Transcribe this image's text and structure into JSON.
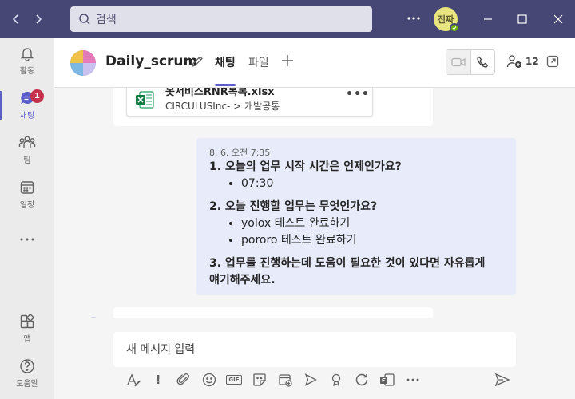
{
  "search": {
    "placeholder": "검색"
  },
  "titlebar": {
    "avatar_initials": "진짜",
    "presence": "available"
  },
  "rail": {
    "items": [
      {
        "label": "활동",
        "icon": "bell-icon"
      },
      {
        "label": "채팅",
        "icon": "chat-icon",
        "badge": "1",
        "active": true
      },
      {
        "label": "팀",
        "icon": "teams-icon"
      },
      {
        "label": "일정",
        "icon": "calendar-icon"
      },
      {
        "label": "",
        "icon": "more-icon"
      },
      {
        "label": "앱",
        "icon": "apps-icon"
      },
      {
        "label": "도움말",
        "icon": "help-icon"
      }
    ]
  },
  "header": {
    "title": "Daily_scrum",
    "tabs": [
      {
        "label": "채팅",
        "active": true
      },
      {
        "label": "파일",
        "active": false
      }
    ],
    "participants_count": "12"
  },
  "file_attachment": {
    "name": "못서비스RNR복록.xlsx",
    "path_root": "CIRCULUSInc-",
    "path_folder": "개발공통"
  },
  "my_message": {
    "timestamp": "8. 6. 오전 7:35",
    "q1": "1. 오늘의 업무 시작 시간은 언제인가요?",
    "q1_answers": [
      "07:30"
    ],
    "q2": "2. 오늘 진행할 업무는 무엇인가요?",
    "q2_answers": [
      "yolox 테스트 완료하기",
      "pororo 테스트 완료하기"
    ],
    "q3_line1": "3. 업무를 진행하는데 도움이 필요한 것이 있다면 자유롭게",
    "q3_line2": "얘기해주세요."
  },
  "compose": {
    "placeholder": "새 메시지 입력"
  },
  "colors": {
    "titlebar": "#464775",
    "accent": "#5b5fc7",
    "my_bubble": "#e8ebfa",
    "badge": "#c4314b"
  }
}
